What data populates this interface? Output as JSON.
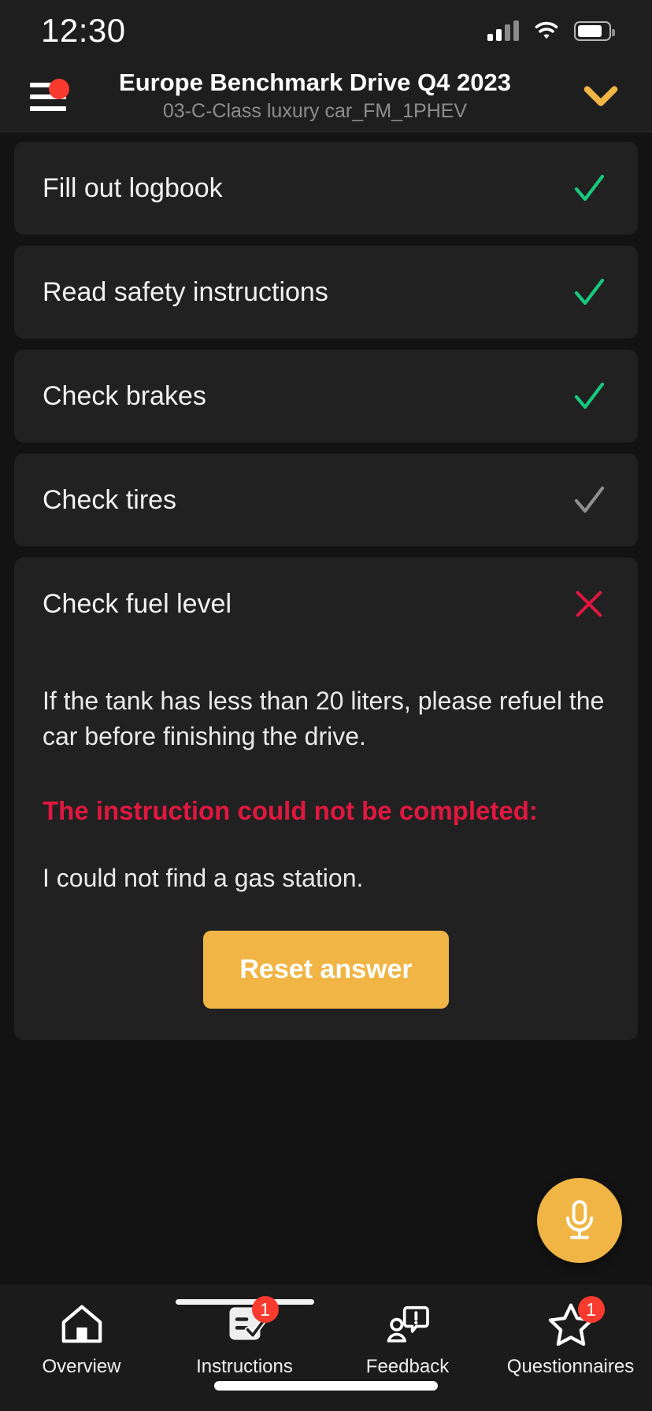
{
  "status_bar": {
    "time": "12:30",
    "signal_icon": "cellular-signal-icon",
    "wifi_icon": "wifi-icon",
    "battery_icon": "battery-icon"
  },
  "header": {
    "menu_icon": "hamburger-menu-icon",
    "menu_badge_visible": true,
    "title": "Europe Benchmark Drive Q4 2023",
    "subtitle": "03-C-Class luxury car_FM_1PHEV",
    "dropdown_icon": "chevron-down-icon",
    "accent_color": "#f0b544"
  },
  "instructions": [
    {
      "title": "Fill out logbook",
      "status": "completed",
      "mark": "check",
      "mark_color": "#17c97c"
    },
    {
      "title": "Read safety instructions",
      "status": "completed",
      "mark": "check",
      "mark_color": "#17c97c"
    },
    {
      "title": "Check brakes",
      "status": "completed",
      "mark": "check",
      "mark_color": "#17c97c"
    },
    {
      "title": "Check tires",
      "status": "pending",
      "mark": "check",
      "mark_color": "#8f8f8f"
    },
    {
      "title": "Check fuel level",
      "status": "failed",
      "mark": "cross",
      "mark_color": "#e0173f"
    }
  ],
  "expanded_card": {
    "title": "Check fuel level",
    "description": "If the tank has less than 20 liters, please refuel the car before finishing the drive.",
    "error_heading": "The instruction could not be completed:",
    "answer": "I could not find a gas station.",
    "reset_button": "Reset answer",
    "error_color": "#e0173f",
    "button_color": "#f0b544"
  },
  "voice_button": {
    "icon": "microphone-icon",
    "color": "#f0b544"
  },
  "bottom_nav": {
    "items": [
      {
        "label": "Overview",
        "icon": "home-icon",
        "badge": "",
        "active": false
      },
      {
        "label": "Instructions",
        "icon": "checklist-icon",
        "badge": "1",
        "active": true
      },
      {
        "label": "Feedback",
        "icon": "feedback-icon",
        "badge": "",
        "active": false
      },
      {
        "label": "Questionnaires",
        "icon": "star-icon",
        "badge": "1",
        "active": false
      }
    ]
  }
}
